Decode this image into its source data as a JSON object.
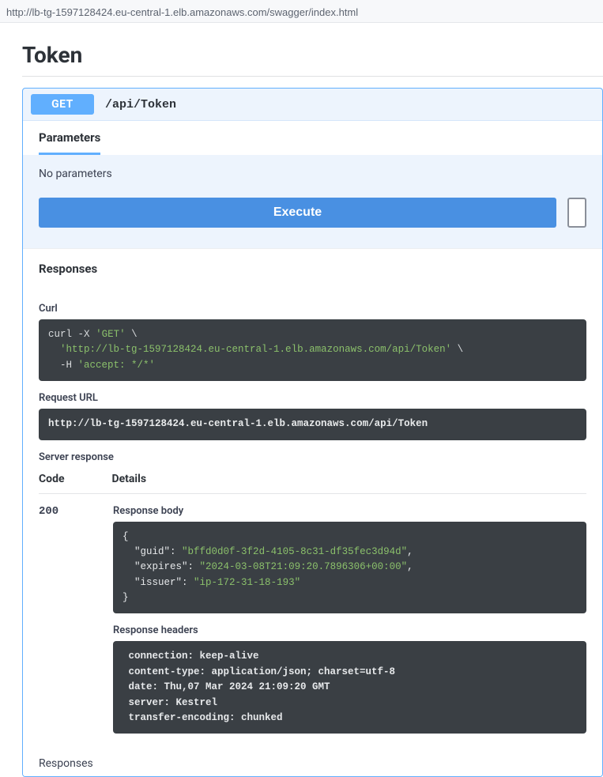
{
  "browser": {
    "url": "http://lb-tg-1597128424.eu-central-1.elb.amazonaws.com/swagger/index.html"
  },
  "section": {
    "title": "Token"
  },
  "op": {
    "method": "GET",
    "path": "/api/Token",
    "parameters_tab": "Parameters",
    "no_params_text": "No parameters",
    "execute_label": "Execute"
  },
  "responses": {
    "header": "Responses",
    "curl_label": "Curl",
    "curl_cmd": "curl",
    "curl_flag_x": "-X",
    "curl_method_str": "'GET'",
    "curl_backslash": "\\",
    "curl_url_str": "'http://lb-tg-1597128424.eu-central-1.elb.amazonaws.com/api/Token'",
    "curl_flag_h": "-H",
    "curl_accept_str": "'accept: */*'",
    "request_url_label": "Request URL",
    "request_url": "http://lb-tg-1597128424.eu-central-1.elb.amazonaws.com/api/Token",
    "server_response_label": "Server response",
    "table": {
      "code": "Code",
      "details": "Details"
    },
    "status_code": "200",
    "body_label": "Response body",
    "body_json": {
      "guid": "bffd0d0f-3f2d-4105-8c31-df35fec3d94d",
      "expires": "2024-03-08T21:09:20.7896306+00:00",
      "issuer": "ip-172-31-18-193"
    },
    "headers_label": "Response headers",
    "headers_lines": [
      " connection: keep-alive ",
      " content-type: application/json; charset=utf-8 ",
      " date: Thu,07 Mar 2024 21:09:20 GMT ",
      " server: Kestrel ",
      " transfer-encoding: chunked "
    ],
    "footer": "Responses"
  }
}
